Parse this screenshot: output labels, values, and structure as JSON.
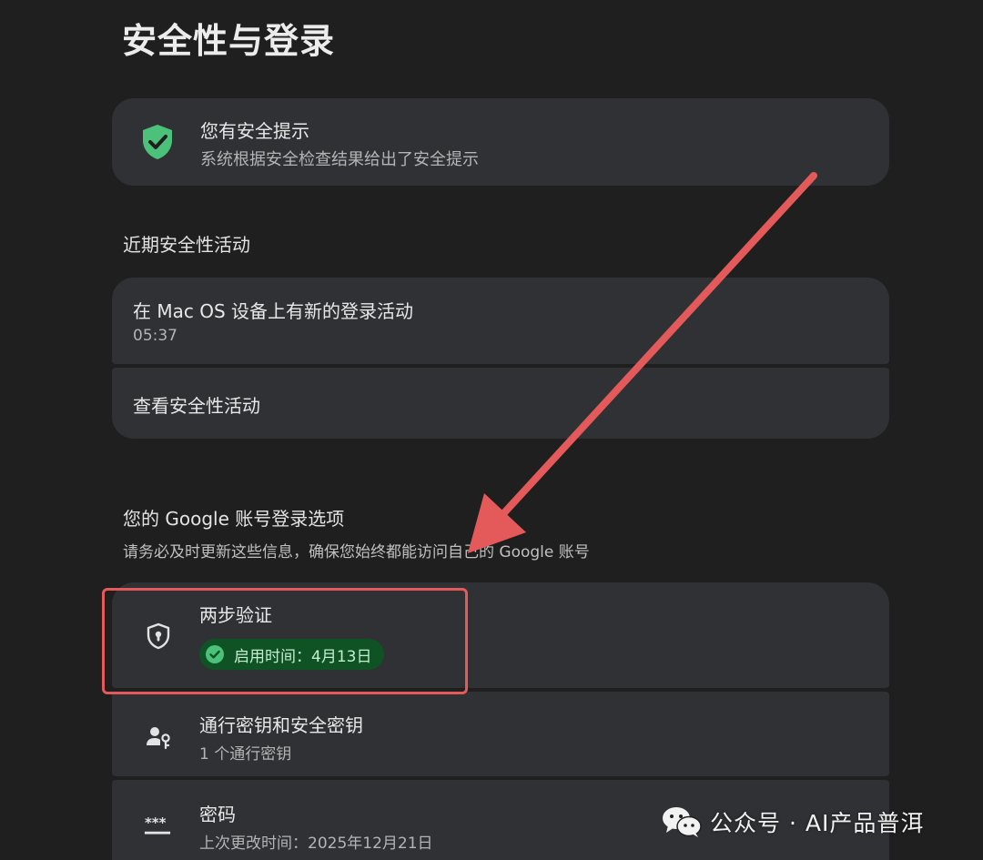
{
  "page": {
    "title": "安全性与登录"
  },
  "security_tip": {
    "title": "您有安全提示",
    "subtitle": "系统根据安全检查结果给出了安全提示",
    "icon": "shield-check-icon",
    "icon_color": "#4cc17a"
  },
  "recent_activity": {
    "section_title": "近期安全性活动",
    "items": [
      {
        "title": "在 Mac OS 设备上有新的登录活动",
        "subtitle": "05:37"
      },
      {
        "title": "查看安全性活动"
      }
    ]
  },
  "sign_in_options": {
    "section_title": "您的 Google 账号登录选项",
    "section_subtitle": "请务必及时更新这些信息，确保您始终都能访问自己的 Google 账号",
    "items": [
      {
        "title": "两步验证",
        "badge": "启用时间：4月13日",
        "icon": "shield-keyhole-icon"
      },
      {
        "title": "通行密钥和安全密钥",
        "subtitle": "1 个通行密钥",
        "icon": "person-key-icon"
      },
      {
        "title": "密码",
        "subtitle": "上次更改时间：2025年12月21日",
        "icon": "password-dots-icon"
      }
    ]
  },
  "annotation": {
    "color": "#e45a5a"
  },
  "watermark": {
    "text": "公众号 · AI产品普洱",
    "icon": "wechat-icon"
  }
}
